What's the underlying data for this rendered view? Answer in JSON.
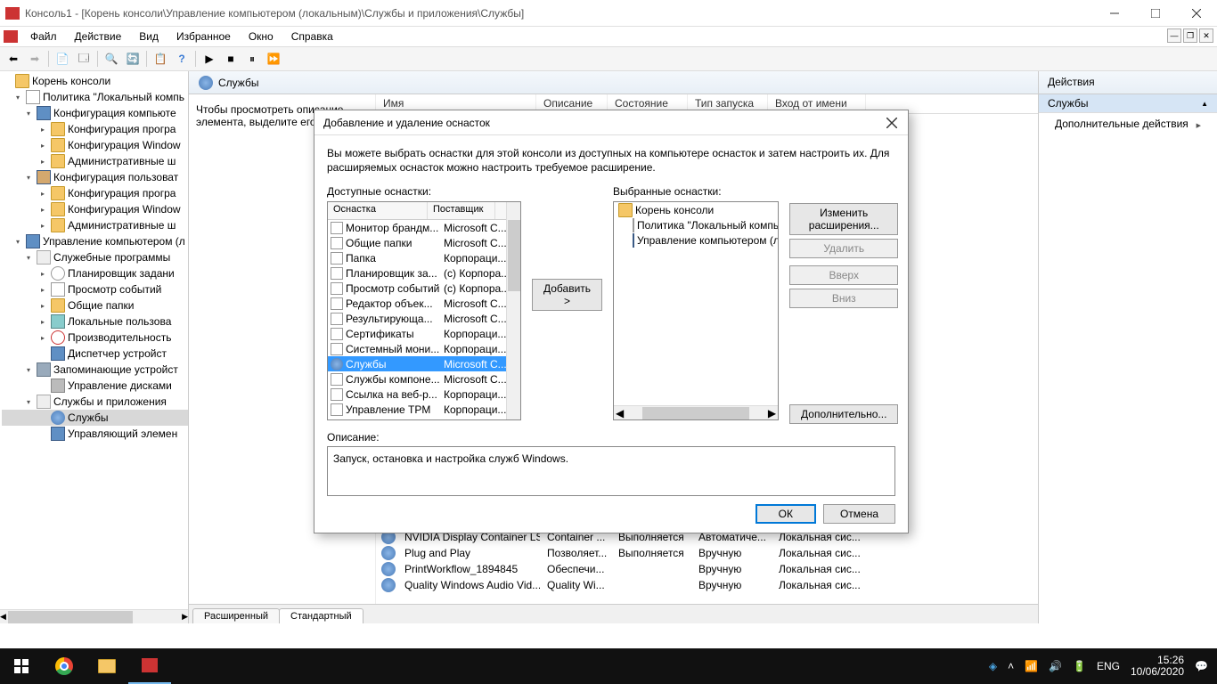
{
  "titlebar": {
    "title": "Консоль1 - [Корень консоли\\Управление компьютером (локальным)\\Службы и приложения\\Службы]"
  },
  "menu": {
    "file": "Файл",
    "action": "Действие",
    "view": "Вид",
    "fav": "Избранное",
    "window": "Окно",
    "help": "Справка"
  },
  "tree": {
    "root": "Корень консоли",
    "pol": "Политика \"Локальный компь",
    "kk": "Конфигурация компьюте",
    "kp": "Конфигурация програ",
    "kw": "Конфигурация Window",
    "ash": "Административные ш",
    "ku": "Конфигурация пользоват",
    "mgmt": "Управление компьютером (л",
    "svcprog": "Служебные программы",
    "sched": "Планировщик задани",
    "evt": "Просмотр событий",
    "shared": "Общие папки",
    "lusers": "Локальные пользова",
    "perf": "Производительность",
    "devmgr": "Диспетчер устройст",
    "storage": "Запоминающие устройст",
    "disk": "Управление дисками",
    "svcapp": "Службы и приложения",
    "svc": "Службы",
    "wmi": "Управляющий элемен"
  },
  "center": {
    "header": "Службы",
    "desc1": "Чтобы просмотреть описание",
    "desc2": "элемента, выделите его",
    "cols": {
      "name": "Имя",
      "desc": "Описание",
      "state": "Состояние",
      "start": "Тип запуска",
      "logon": "Вход от имени"
    },
    "rows": [
      {
        "n": "NVIDIA Display Container LS",
        "d": "Container ...",
        "s": "Выполняется",
        "t": "Автоматиче...",
        "l": "Локальная сис..."
      },
      {
        "n": "Plug and Play",
        "d": "Позволяет...",
        "s": "Выполняется",
        "t": "Вручную",
        "l": "Локальная сис..."
      },
      {
        "n": "PrintWorkflow_1894845",
        "d": "Обеспечи...",
        "s": "",
        "t": "Вручную",
        "l": "Локальная сис..."
      },
      {
        "n": "Quality Windows Audio Vid...",
        "d": "Quality Wi...",
        "s": "",
        "t": "Вручную",
        "l": "Локальная сис..."
      }
    ],
    "tabs": {
      "ext": "Расширенный",
      "std": "Стандартный"
    }
  },
  "actions": {
    "title": "Действия",
    "sub": "Службы",
    "more": "Дополнительные действия"
  },
  "dialog": {
    "title": "Добавление и удаление оснасток",
    "intro": "Вы можете выбрать оснастки для этой консоли из доступных на компьютере оснасток и затем настроить их. Для расширяемых оснасток можно настроить требуемое расширение.",
    "avail_label": "Доступные оснастки:",
    "sel_label": "Выбранные оснастки:",
    "hdr_snap": "Оснастка",
    "hdr_vendor": "Поставщик",
    "snapins": [
      {
        "n": "Монитор брандм...",
        "v": "Microsoft C..."
      },
      {
        "n": "Общие папки",
        "v": "Microsoft C..."
      },
      {
        "n": "Папка",
        "v": "Корпораци..."
      },
      {
        "n": "Планировщик за...",
        "v": "(с) Корпора..."
      },
      {
        "n": "Просмотр событий",
        "v": "(с) Корпора..."
      },
      {
        "n": "Редактор объек...",
        "v": "Microsoft C..."
      },
      {
        "n": "Результирующа...",
        "v": "Microsoft C..."
      },
      {
        "n": "Сертификаты",
        "v": "Корпораци..."
      },
      {
        "n": "Системный мони...",
        "v": "Корпораци..."
      },
      {
        "n": "Службы",
        "v": "Microsoft C...",
        "sel": true
      },
      {
        "n": "Службы компоне...",
        "v": "Microsoft C..."
      },
      {
        "n": "Ссылка на веб-р...",
        "v": "Корпораци..."
      },
      {
        "n": "Управление TPM",
        "v": "Корпораци..."
      }
    ],
    "selected": {
      "root": "Корень консоли",
      "pol": "Политика \"Локальный компь",
      "mgmt": "Управление компьютером (ло"
    },
    "btns": {
      "add": "Добавить >",
      "ext": "Изменить расширения...",
      "del": "Удалить",
      "up": "Вверх",
      "down": "Вниз",
      "adv": "Дополнительно...",
      "ok": "ОК",
      "cancel": "Отмена"
    },
    "desc_label": "Описание:",
    "desc_text": "Запуск, остановка и настройка служб Windows."
  },
  "taskbar": {
    "lang": "ENG",
    "time": "15:26",
    "date": "10/06/2020"
  }
}
